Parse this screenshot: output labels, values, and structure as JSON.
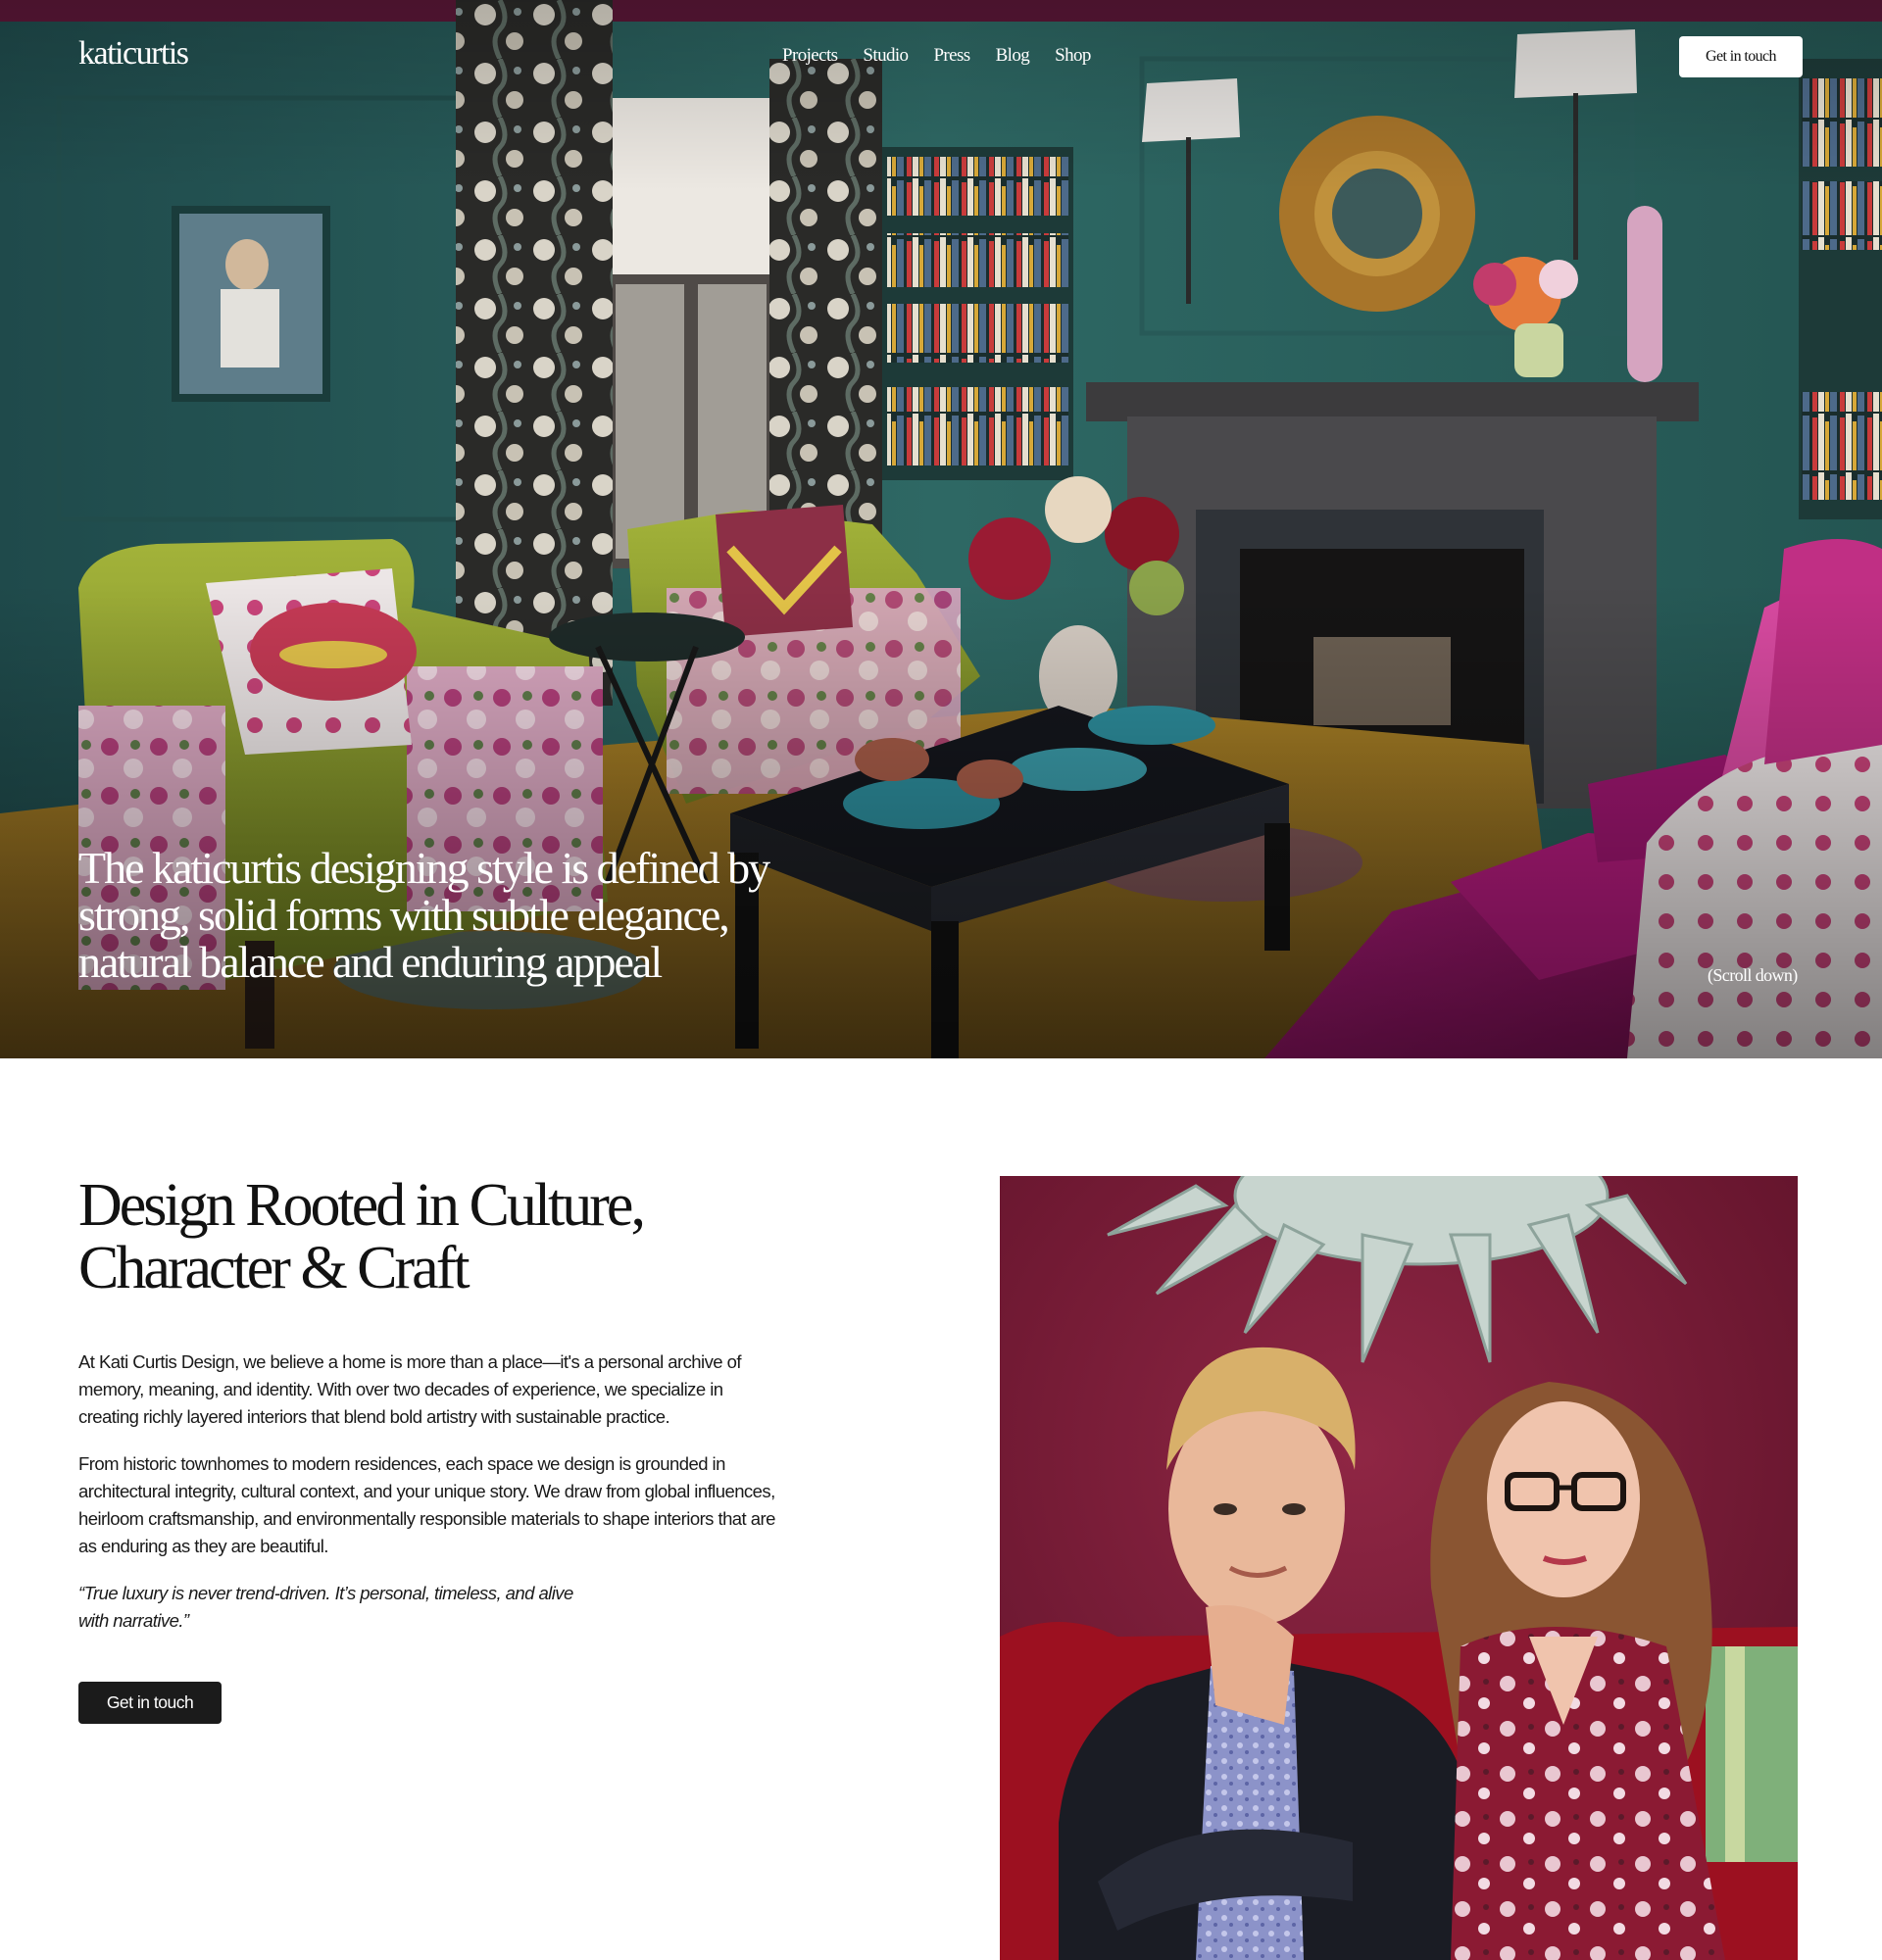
{
  "nav": {
    "logo": "katicurtis",
    "items": [
      "Projects",
      "Studio",
      "Press",
      "Blog",
      "Shop"
    ],
    "cta": "Get in touch"
  },
  "hero": {
    "headline": "The katicurtis designing style is defined by strong, solid forms with subtle elegance, natural balance and enduring appeal",
    "scroll_hint": "(Scroll down)"
  },
  "about": {
    "heading_line1": "Design Rooted in Culture,",
    "heading_line2": "Character & Craft",
    "paragraph1": "At Kati Curtis Design, we believe a home is more than a place—it's a personal archive of memory, meaning, and identity. With over two decades of experience, we specialize in creating richly layered interiors that blend bold artistry with sustainable practice.",
    "paragraph2": "From historic townhomes to modern residences, each space we design is grounded in architectural integrity, cultural context, and your unique story. We draw from global influences, heirloom craftsmanship, and environmentally responsible materials to shape interiors that are as enduring as they are beautiful.",
    "quote": "“True luxury is never trend-driven. It’s personal, timeless, and alive with narrative.”",
    "cta": "Get in touch"
  },
  "colors": {
    "wall_teal": "#2d6462",
    "sofa_magenta": "#a3186f",
    "chair_green": "#8d9b2e",
    "rug_gold": "#b98a2a",
    "portrait_wall": "#7d1d3a",
    "button_dark": "#1b1b1b"
  }
}
